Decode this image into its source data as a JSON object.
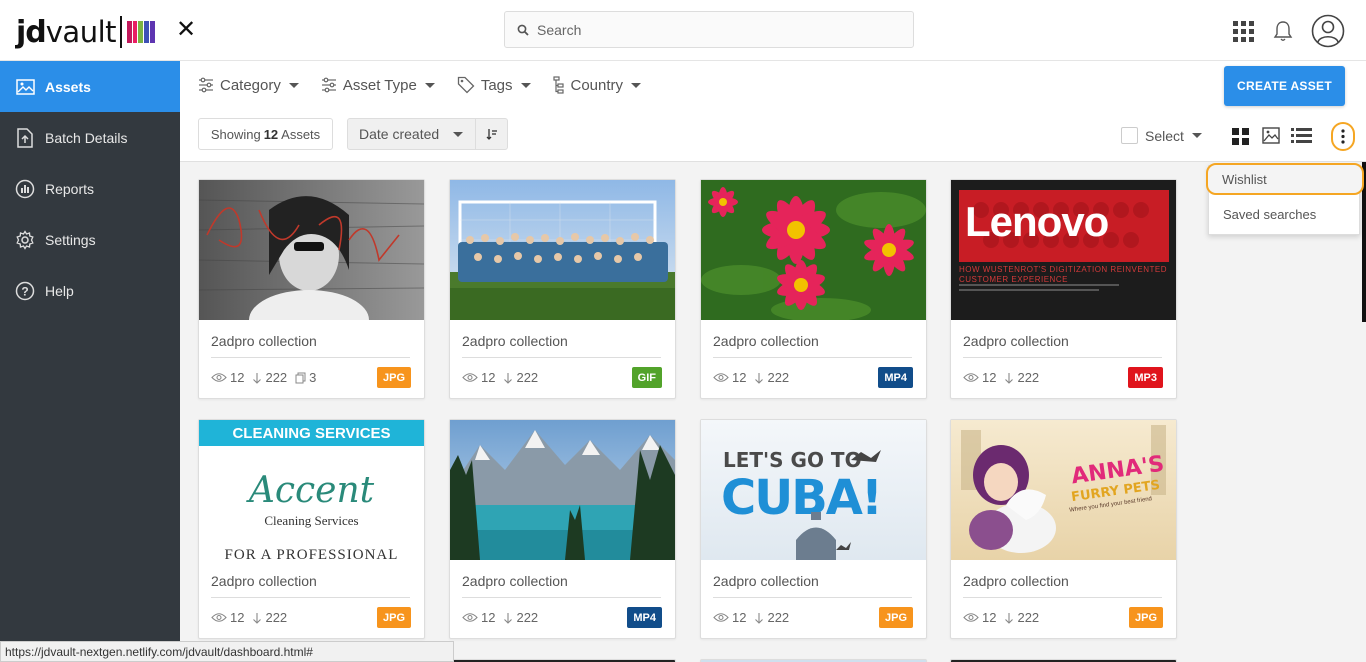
{
  "header": {
    "logo_jd": "jd",
    "logo_vault": "vault",
    "logo_mark_colors": [
      "#c2185b",
      "#e91e63",
      "#7cb342",
      "#3f51b5",
      "#5e35b1"
    ],
    "close_label": "✕",
    "search_placeholder": "Search"
  },
  "sidebar": {
    "items": [
      {
        "label": "Assets",
        "icon": "image-icon",
        "active": true
      },
      {
        "label": "Batch Details",
        "icon": "upload-file-icon",
        "active": false
      },
      {
        "label": "Reports",
        "icon": "chart-icon",
        "active": false
      },
      {
        "label": "Settings",
        "icon": "gear-icon",
        "active": false
      },
      {
        "label": "Help",
        "icon": "help-icon",
        "active": false
      }
    ]
  },
  "filters": {
    "category": "Category",
    "asset_type": "Asset Type",
    "tags": "Tags",
    "country": "Country"
  },
  "create_button": "CREATE ASSET",
  "showing": {
    "prefix": "Showing",
    "count": "12",
    "suffix": "Assets"
  },
  "sort": {
    "selected": "Date created"
  },
  "select_label": "Select",
  "more_menu": {
    "items": [
      "Wishlist",
      "Saved searches"
    ]
  },
  "cards": [
    {
      "title": "2adpro collection",
      "views": "12",
      "downloads": "222",
      "copies": "3",
      "type": "JPG",
      "type_color": "#f7941d"
    },
    {
      "title": "2adpro collection",
      "views": "12",
      "downloads": "222",
      "copies": "",
      "type": "GIF",
      "type_color": "#52a32a"
    },
    {
      "title": "2adpro collection",
      "views": "12",
      "downloads": "222",
      "copies": "",
      "type": "MP4",
      "type_color": "#114d8a"
    },
    {
      "title": "2adpro collection",
      "views": "12",
      "downloads": "222",
      "copies": "",
      "type": "MP3",
      "type_color": "#e0141c"
    },
    {
      "title": "2adpro collection",
      "views": "12",
      "downloads": "222",
      "copies": "",
      "type": "JPG",
      "type_color": "#f7941d"
    },
    {
      "title": "2adpro collection",
      "views": "12",
      "downloads": "222",
      "copies": "",
      "type": "MP4",
      "type_color": "#114d8a"
    },
    {
      "title": "2adpro collection",
      "views": "12",
      "downloads": "222",
      "copies": "",
      "type": "JPG",
      "type_color": "#f7941d"
    },
    {
      "title": "2adpro collection",
      "views": "12",
      "downloads": "222",
      "copies": "",
      "type": "JPG",
      "type_color": "#f7941d"
    }
  ],
  "thumbs": {
    "card4_brand": "Lenovo",
    "card4_tagline": "HOW WUSTENROT'S DIGITIZATION REINVENTED CUSTOMER EXPERIENCE",
    "card5_top": "CLEANING SERVICES",
    "card5_brand": "Accent",
    "card5_sub": "Cleaning Services",
    "card5_bottom": "FOR A PROFESSIONAL",
    "card7_top": "LET'S GO TO",
    "card7_main": "CUBA!",
    "card8_main": "ANNA'S",
    "card8_sub": "FURRY PETS",
    "card8_tag": "Where you find your best friend"
  },
  "status_url": "https://jdvault-nextgen.netlify.com/jdvault/dashboard.html#"
}
